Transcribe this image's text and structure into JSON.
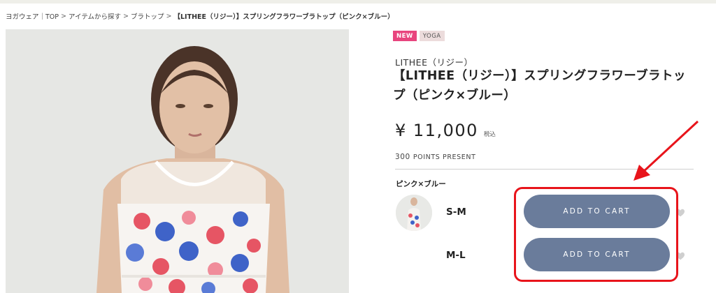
{
  "breadcrumb": [
    {
      "label": "ヨガウェア｜TOP"
    },
    {
      "label": "アイテムから探す"
    },
    {
      "label": "ブラトップ"
    },
    {
      "label": "【LITHEE（リジー）】スプリングフラワーブラトップ（ピンク×ブルー）"
    }
  ],
  "breadcrumb_sep": ">",
  "badges": {
    "new": "NEW",
    "category": "YOGA"
  },
  "product": {
    "brand": "LITHEE（リジー）",
    "title": "【LITHEE（リジー）】スプリングフラワーブラトップ（ピンク×ブルー）",
    "price": "¥ 11,000",
    "tax_label": "税込",
    "points_num": "300",
    "points_label": "POINTS PRESENT",
    "color_name": "ピンク×ブルー"
  },
  "variants": [
    {
      "size": "S-M",
      "button": "ADD TO CART"
    },
    {
      "size": "M-L",
      "button": "ADD TO CART"
    }
  ],
  "colors": {
    "new_badge": "#e8457e",
    "cart_button": "#6a7c9b",
    "highlight": "#e8141b"
  },
  "icons": {
    "favorite": "heart-icon",
    "annotation": "red-arrow"
  }
}
